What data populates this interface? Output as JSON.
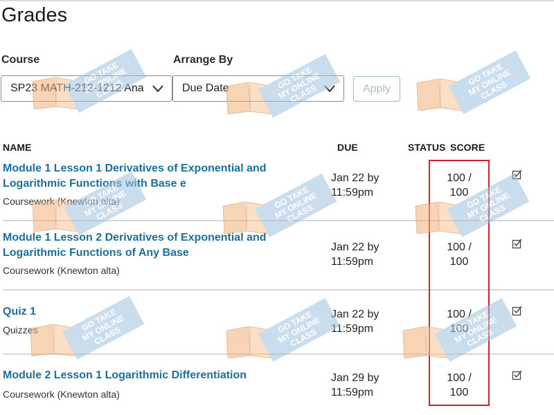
{
  "page": {
    "title": "Grades"
  },
  "filters": {
    "course_label": "Course",
    "course_value": "SP23 MATH-212-1212 Ana",
    "arrange_label": "Arrange By",
    "arrange_value": "Due Date",
    "apply_label": "Apply"
  },
  "table": {
    "headers": {
      "name": "NAME",
      "due": "DUE",
      "status": "STATUS",
      "score": "SCORE"
    },
    "rows": [
      {
        "title": "Module 1 Lesson 1 Derivatives of Exponential and Logarithmic Functions with Base e",
        "type": "Coursework (Knewton alta)",
        "due_line1": "Jan 22 by",
        "due_line2": "11:59pm",
        "score_line1": "100 /",
        "score_line2": "100"
      },
      {
        "title": "Module 1 Lesson 2 Derivatives of Exponential and Logarithmic Functions of Any Base",
        "type": "Coursework (Knewton alta)",
        "due_line1": "Jan 22 by",
        "due_line2": "11:59pm",
        "score_line1": "100 /",
        "score_line2": "100"
      },
      {
        "title": "Quiz 1",
        "type": "Quizzes",
        "due_line1": "Jan 22 by",
        "due_line2": "11:59pm",
        "score_line1": "100 /",
        "score_line2": "100"
      },
      {
        "title": "Module 2 Lesson 1 Logarithmic Differentiation",
        "type": "Coursework (Knewton alta)",
        "due_line1": "Jan 29 by",
        "due_line2": "11:59pm",
        "score_line1": "100 /",
        "score_line2": "100"
      }
    ]
  },
  "watermark": {
    "line1": "GO TAKE",
    "line2": "MY ONLINE",
    "line3": "CLASS"
  },
  "colors": {
    "link": "#1b6f9a",
    "highlight": "#c8232f",
    "watermark_book": "#f2b27a",
    "watermark_banner": "#9dc3df"
  },
  "icons": {
    "dropdown": "chevron-down-icon",
    "row_action": "edit-assignment-icon"
  }
}
